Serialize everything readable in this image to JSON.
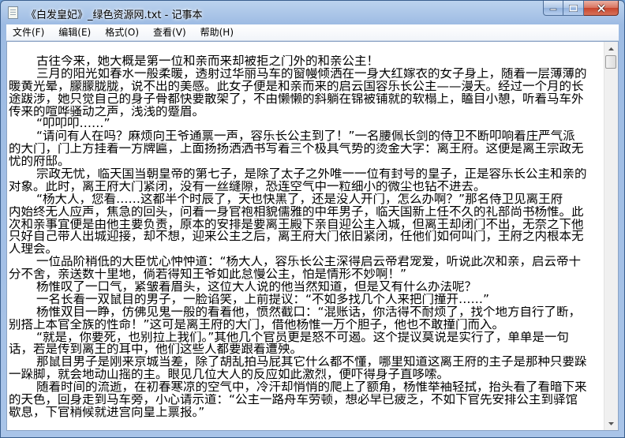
{
  "window": {
    "title": "《白发皇妃》_绿色资源网.txt - 记事本",
    "icons": {
      "app": "notepad-icon",
      "minimize": "minimize-icon",
      "maximize": "maximize-icon",
      "close": "close-icon"
    }
  },
  "menu": [
    {
      "label": "文件(F)"
    },
    {
      "label": "编辑(E)"
    },
    {
      "label": "格式(O)"
    },
    {
      "label": "查看(V)"
    },
    {
      "label": "帮助(H)"
    }
  ],
  "scroll_position": 0.0,
  "content": {
    "lines": [
      {
        "text": "古往今来，她大概是第一位和亲而来却被拒之门外的和亲公主！",
        "indent": true
      },
      {
        "text": "三月的阳光如春水一般柔暖，透射过华丽马车的窗幔倾洒在一身大红嫁衣的女子身上，随着一层薄薄的",
        "indent": true
      },
      {
        "text": "暖黄光晕，朦朦胧胧，说不出的美感。此女子便是和亲而来的启云国容乐长公主——漫夭。经过一个月的长",
        "indent": false
      },
      {
        "text": "途跋涉，她只觉自己的身子骨都快要散架了，不由懒懒的斜躺在锦被铺就的软榻上，瞌目小憩，听着马车外",
        "indent": false
      },
      {
        "text": "传来的喧哗骚动之声，浅浅的蹙眉。",
        "indent": false
      },
      {
        "text": "“叩叩叩……”",
        "indent": true
      },
      {
        "text": "“请问有人在吗？麻烦向王爷通禀一声，容乐长公主到了！”一名腰佩长剑的侍卫不断叩响着庄严气派",
        "indent": true
      },
      {
        "text": "的大门，门上方挂着一方牌匾，上面扬扬洒洒书写着三个极具气势的烫金大字：离王府。这便是离王宗政无",
        "indent": false
      },
      {
        "text": "忧的府邸。",
        "indent": false
      },
      {
        "text": "宗政无忧，临天国当朝皇帝的第七子，是除了太子之外唯一一位有封号的皇子，正是容乐长公主和亲的",
        "indent": true
      },
      {
        "text": "对象。此时，离王府大门紧闭，没有一丝缝隙，恐连空气中一粒细小的微尘也钻不进去。",
        "indent": false
      },
      {
        "text": "“杨大人，您看……这都半个时辰了，天也快黑了，还是没人开门，怎么办啊？”那名侍卫见离王府",
        "indent": true
      },
      {
        "text": "内始终无人应声，焦急的回头，问着一身官袍相貌儒雅的中年男子，临天国新上任不久的礼部尚书杨惟。此",
        "indent": false
      },
      {
        "text": "次和亲事宜便是由他主要负责，原本的安排是要离王殿下亲自迎公主入城，但离王却闭门不出，无奈之下他",
        "indent": false
      },
      {
        "text": "只好自己带人出城迎接，却不想，迎来公主之后，离王府大门依旧紧闭，任他们如何叫门，王府之内根本无",
        "indent": false
      },
      {
        "text": "人理会。",
        "indent": false
      },
      {
        "text": "一位品阶稍低的大臣忧心忡忡道：“杨大人，容乐长公主深得启云帝君宠爱，听说此次和亲，启云帝十",
        "indent": true
      },
      {
        "text": "分不舍，亲送数十里地，倘若得知王爷如此怠慢公主，怕是情形不妙啊！”",
        "indent": false
      },
      {
        "text": "杨惟叹了一口气，紧皱着眉头，这位大人说的他当然知道，但是又有什么办法呢？",
        "indent": true
      },
      {
        "text": "一名长着一双鼠目的男子，一脸谄笑，上前提议：“不如多找几个人来把门撞开……”",
        "indent": true
      },
      {
        "text": "杨惟双目一睁，仿佛见鬼一般的看着他，愤然截口：“混账话，你活得不耐烦了，找个地方自行了断，",
        "indent": true
      },
      {
        "text": "别搭上本官全族的性命！”这可是离王府的大门，借他杨惟一万个胆子，他也不敢撞门而入。",
        "indent": false
      },
      {
        "text": "“就是，你要死，也别拉上我们。”其他几个官员更是怒不可遏。这个提议莫说是实行了，单单是一句",
        "indent": true
      },
      {
        "text": "话，若是传到离王的耳中，他们这些人都要跟着遭殃。",
        "indent": false
      },
      {
        "text": "那鼠目男子是刚来京城当差，除了胡乱拍马屁其它什么都不懂，哪里知道这离王府的主子是那种只要跺",
        "indent": true
      },
      {
        "text": "一跺脚，就会地动山摇的主。眼见几位大人的反应如此激烈，便吓得身子直哆嗦。",
        "indent": false
      },
      {
        "text": "随着时间的流逝，在初春寒凉的空气中，冷汗却悄悄的爬上了额角，杨惟举袖轻拭，抬头看了看暗下来",
        "indent": true
      },
      {
        "text": "的天色，回身走到马车旁，小心请示道：“公主一路舟车劳顿，想必早已疲乏，不如下官先安排公主到驿馆",
        "indent": false
      },
      {
        "text": "歇息，下官稍候就进宫向皇上禀报。”",
        "indent": false
      }
    ]
  }
}
